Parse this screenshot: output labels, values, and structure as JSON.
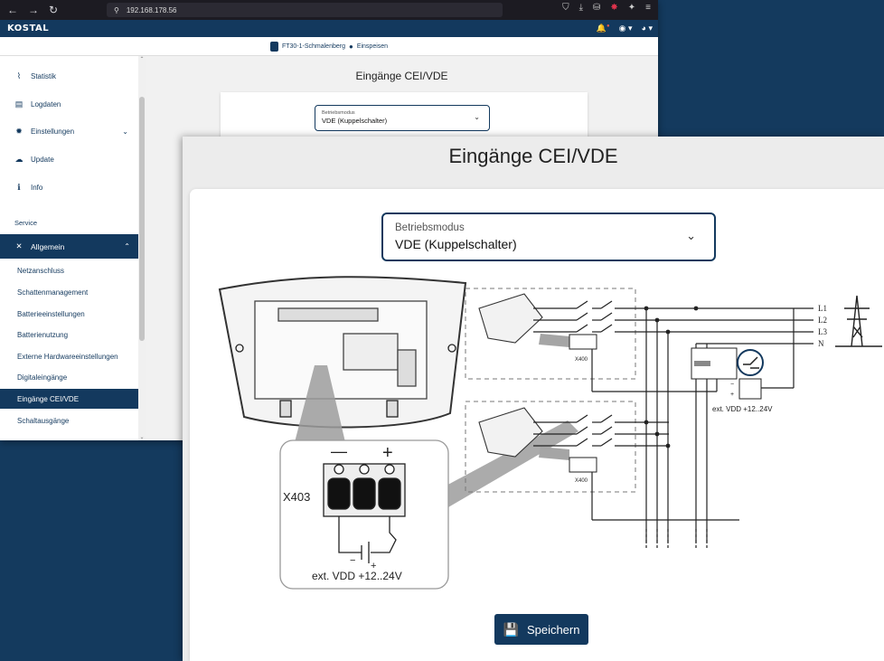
{
  "browser": {
    "url": "192.168.178.56",
    "nav_back": "←",
    "nav_forward": "→",
    "nav_reload": "↻",
    "toolbar_icons": [
      "⛉",
      "⤓",
      "⛁",
      "✸",
      "✦",
      "≡"
    ]
  },
  "app": {
    "logo": "KOSTAL",
    "header_icons": [
      "🔔",
      "◉ ▾",
      "◕ ▾"
    ],
    "status": {
      "device": "FT30-1-Schmalenberg",
      "separator": "●",
      "mode": "Einspeisen"
    }
  },
  "sidebar": {
    "items": [
      {
        "label": "Statistik",
        "icon": "chart-icon",
        "glyph": "⌇"
      },
      {
        "label": "Logdaten",
        "icon": "document-icon",
        "glyph": "▤"
      },
      {
        "label": "Einstellungen",
        "icon": "gear-icon",
        "glyph": "✹",
        "chevron": "⌄"
      },
      {
        "label": "Update",
        "icon": "cloud-icon",
        "glyph": "☁"
      },
      {
        "label": "Info",
        "icon": "info-icon",
        "glyph": "ℹ"
      }
    ],
    "section_service": "Service",
    "group": {
      "label": "Allgemein",
      "icon": "tools-icon",
      "glyph": "✕",
      "chevron": "⌃"
    },
    "subitems": [
      "Netzanschluss",
      "Schattenmanagement",
      "Batterieeinstellungen",
      "Batterienutzung",
      "Externe Hardwareeinstellungen",
      "Digitaleingänge",
      "Eingänge CEI/VDE",
      "Schaltausgänge"
    ],
    "active_subitem": "Eingänge CEI/VDE",
    "scroll_up": "⌃",
    "scroll_down": "⌄"
  },
  "page": {
    "title": "Eingänge CEI/VDE",
    "mode_select": {
      "label": "Betriebsmodus",
      "value": "VDE (Kuppelschalter)",
      "chevron": "⌄"
    },
    "save_button": "Speichern",
    "save_icon": "💾"
  },
  "diagram": {
    "connector": "X403",
    "minus": "—",
    "plus": "+",
    "supply_label": "ext. VDD +12..24V",
    "supply_label_small": "ext. VDD +12..24V",
    "terminal_small": "X400",
    "terminal_minus_small": "−",
    "terminal_plus_small": "+",
    "phases": [
      "L1",
      "L2",
      "L3",
      "N"
    ]
  },
  "colors": {
    "primary": "#13395e",
    "background": "#143a5e",
    "browser_bar": "#1c1b22",
    "card": "#ffffff"
  }
}
